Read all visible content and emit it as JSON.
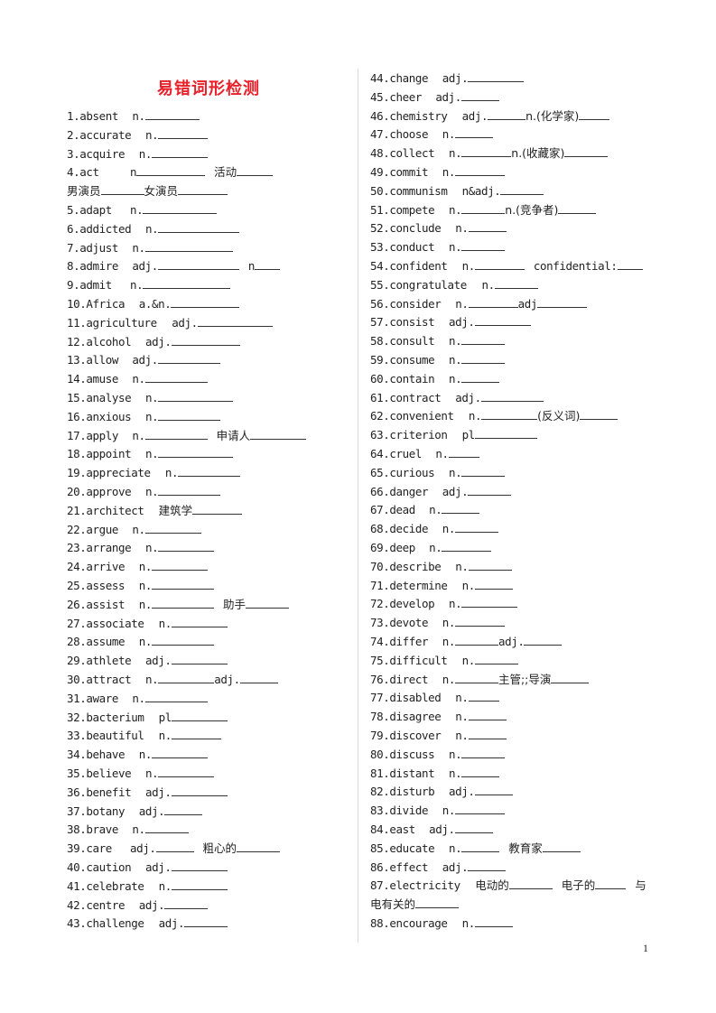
{
  "title": "易错词形检测",
  "page_number": "1",
  "left_items": [
    {
      "n": "1",
      "word": "absent",
      "parts": [
        [
          "n.",
          60
        ]
      ]
    },
    {
      "n": "2",
      "word": "accurate",
      "parts": [
        [
          "n.",
          55
        ]
      ]
    },
    {
      "n": "3",
      "word": "acquire",
      "parts": [
        [
          "n.",
          62
        ]
      ]
    },
    {
      "n": "4",
      "word": "act",
      "parts": [
        [
          "n",
          76
        ],
        [
          "活动",
          40
        ]
      ]
    },
    {
      "n": "",
      "word": "",
      "parts": [
        [
          "男演员",
          48
        ],
        [
          "女演员",
          55
        ]
      ],
      "continuation": true
    },
    {
      "n": "5",
      "word": "adapt",
      "parts": [
        [
          "n.",
          82
        ]
      ]
    },
    {
      "n": "6",
      "word": "addicted",
      "parts": [
        [
          "n.",
          90
        ]
      ]
    },
    {
      "n": "7",
      "word": "adjust",
      "parts": [
        [
          "n.",
          97
        ]
      ]
    },
    {
      "n": "8",
      "word": "admire",
      "parts": [
        [
          "adj.",
          90
        ],
        [
          "n",
          28
        ]
      ]
    },
    {
      "n": "9",
      "word": "admit",
      "parts": [
        [
          "n.",
          97
        ]
      ]
    },
    {
      "n": "10",
      "word": "Africa",
      "parts": [
        [
          "a.&n.",
          76
        ]
      ]
    },
    {
      "n": "11",
      "word": "agriculture",
      "parts": [
        [
          "adj.",
          83
        ]
      ]
    },
    {
      "n": "12",
      "word": "alcohol",
      "parts": [
        [
          "adj.",
          76
        ]
      ]
    },
    {
      "n": "13",
      "word": "allow",
      "parts": [
        [
          "adj.",
          69
        ]
      ]
    },
    {
      "n": "14",
      "word": "amuse",
      "parts": [
        [
          "n.",
          69
        ]
      ]
    },
    {
      "n": "15",
      "word": "analyse",
      "parts": [
        [
          "n.",
          83
        ]
      ]
    },
    {
      "n": "16",
      "word": "anxious",
      "parts": [
        [
          "n.",
          69
        ]
      ]
    },
    {
      "n": "17",
      "word": "apply",
      "parts": [
        [
          "n.",
          69
        ],
        [
          "申请人",
          62
        ]
      ]
    },
    {
      "n": "18",
      "word": "appoint",
      "parts": [
        [
          "n.",
          83
        ]
      ]
    },
    {
      "n": "19",
      "word": "appreciate",
      "parts": [
        [
          "n.",
          69
        ]
      ]
    },
    {
      "n": "20",
      "word": "approve",
      "parts": [
        [
          "n.",
          69
        ]
      ]
    },
    {
      "n": "21",
      "word": "architect",
      "parts": [
        [
          "建筑学",
          55
        ]
      ]
    },
    {
      "n": "22",
      "word": "argue",
      "parts": [
        [
          "n.",
          62
        ]
      ]
    },
    {
      "n": "23",
      "word": "arrange",
      "parts": [
        [
          "n.",
          62
        ]
      ]
    },
    {
      "n": "24",
      "word": "arrive",
      "parts": [
        [
          "n.",
          62
        ]
      ]
    },
    {
      "n": "25",
      "word": "assess",
      "parts": [
        [
          "n.",
          69
        ]
      ]
    },
    {
      "n": "26",
      "word": "assist",
      "parts": [
        [
          "n.",
          69
        ],
        [
          "助手",
          48
        ]
      ]
    },
    {
      "n": "27",
      "word": "associate",
      "parts": [
        [
          "n.",
          62
        ]
      ]
    },
    {
      "n": "28",
      "word": "assume",
      "parts": [
        [
          "n.",
          69
        ]
      ]
    },
    {
      "n": "29",
      "word": "athlete",
      "parts": [
        [
          "adj.",
          62
        ]
      ]
    },
    {
      "n": "30",
      "word": "attract",
      "parts": [
        [
          "n.",
          62
        ],
        [
          "adj.",
          42
        ]
      ]
    },
    {
      "n": "31",
      "word": "aware",
      "parts": [
        [
          "n.",
          69
        ]
      ]
    },
    {
      "n": "32",
      "word": "bacterium",
      "parts": [
        [
          "pl",
          62
        ]
      ]
    },
    {
      "n": "33",
      "word": "beautiful",
      "parts": [
        [
          "n.",
          55
        ]
      ]
    },
    {
      "n": "34",
      "word": "behave",
      "parts": [
        [
          "n.",
          62
        ]
      ]
    },
    {
      "n": "35",
      "word": "believe",
      "parts": [
        [
          "n.",
          62
        ]
      ]
    },
    {
      "n": "36",
      "word": "benefit",
      "parts": [
        [
          "adj.",
          62
        ]
      ]
    },
    {
      "n": "37",
      "word": "botany",
      "parts": [
        [
          "adj.",
          42
        ]
      ]
    },
    {
      "n": "38",
      "word": "brave",
      "parts": [
        [
          "n.",
          48
        ]
      ]
    },
    {
      "n": "39",
      "word": "care",
      "parts": [
        [
          "adj.",
          42
        ],
        [
          "粗心的",
          48
        ]
      ]
    },
    {
      "n": "40",
      "word": "caution",
      "parts": [
        [
          "adj.",
          62
        ]
      ]
    },
    {
      "n": "41",
      "word": "celebrate",
      "parts": [
        [
          "n.",
          62
        ]
      ]
    },
    {
      "n": "42",
      "word": "centre",
      "parts": [
        [
          "adj.",
          48
        ]
      ]
    },
    {
      "n": "43",
      "word": "challenge",
      "parts": [
        [
          "adj.",
          48
        ]
      ]
    }
  ],
  "right_items": [
    {
      "n": "44",
      "word": "change",
      "parts": [
        [
          "adj.",
          62
        ]
      ]
    },
    {
      "n": "45",
      "word": "cheer",
      "parts": [
        [
          "adj.",
          42
        ]
      ]
    },
    {
      "n": "46",
      "word": "chemistry",
      "parts": [
        [
          "adj.",
          42
        ],
        [
          "n.(化学家)",
          34
        ]
      ]
    },
    {
      "n": "47",
      "word": "choose",
      "parts": [
        [
          "n.",
          42
        ]
      ]
    },
    {
      "n": "48",
      "word": "collect",
      "parts": [
        [
          "n.",
          55
        ],
        [
          "n.(收藏家)",
          48
        ]
      ]
    },
    {
      "n": "49",
      "word": "commit",
      "parts": [
        [
          "n.",
          55
        ]
      ]
    },
    {
      "n": "50",
      "word": "communism",
      "parts": [
        [
          "n&adj.",
          48
        ]
      ]
    },
    {
      "n": "51",
      "word": "compete",
      "parts": [
        [
          "n.",
          48
        ],
        [
          "n.(竞争者)",
          42
        ]
      ]
    },
    {
      "n": "52",
      "word": "conclude",
      "parts": [
        [
          "n.",
          42
        ]
      ]
    },
    {
      "n": "53",
      "word": "conduct",
      "parts": [
        [
          "n.",
          48
        ]
      ]
    },
    {
      "n": "54",
      "word": "confident",
      "parts": [
        [
          "n.",
          55
        ],
        [
          "confidential:",
          28
        ]
      ]
    },
    {
      "n": "55",
      "word": "congratulate",
      "parts": [
        [
          "n.",
          48
        ]
      ]
    },
    {
      "n": "56",
      "word": "consider",
      "parts": [
        [
          "n.",
          55
        ],
        [
          "adj",
          55
        ]
      ]
    },
    {
      "n": "57",
      "word": "consist",
      "parts": [
        [
          "adj.",
          62
        ]
      ]
    },
    {
      "n": "58",
      "word": "consult",
      "parts": [
        [
          "n.",
          48
        ]
      ]
    },
    {
      "n": "59",
      "word": "consume",
      "parts": [
        [
          "n.",
          48
        ]
      ]
    },
    {
      "n": "60",
      "word": "contain",
      "parts": [
        [
          "n.",
          42
        ]
      ]
    },
    {
      "n": "61",
      "word": "contract",
      "parts": [
        [
          "adj.",
          69
        ]
      ]
    },
    {
      "n": "62",
      "word": "convenient",
      "parts": [
        [
          "n.",
          62
        ],
        [
          "(反义词)",
          42
        ]
      ]
    },
    {
      "n": "63",
      "word": "criterion",
      "parts": [
        [
          "pl",
          69
        ]
      ]
    },
    {
      "n": "64",
      "word": "cruel",
      "parts": [
        [
          "n.",
          34
        ]
      ]
    },
    {
      "n": "65",
      "word": "curious",
      "parts": [
        [
          "n.",
          48
        ]
      ]
    },
    {
      "n": "66",
      "word": "danger",
      "parts": [
        [
          "adj.",
          48
        ]
      ]
    },
    {
      "n": "67",
      "word": "dead",
      "parts": [
        [
          "n.",
          42
        ]
      ]
    },
    {
      "n": "68",
      "word": "decide",
      "parts": [
        [
          "n.",
          48
        ]
      ]
    },
    {
      "n": "69",
      "word": "deep",
      "parts": [
        [
          "n.",
          55
        ]
      ]
    },
    {
      "n": "70",
      "word": "describe",
      "parts": [
        [
          "n.",
          48
        ]
      ]
    },
    {
      "n": "71",
      "word": "determine",
      "parts": [
        [
          "n.",
          42
        ]
      ]
    },
    {
      "n": "72",
      "word": "develop",
      "parts": [
        [
          "n.",
          62
        ]
      ]
    },
    {
      "n": "73",
      "word": "devote",
      "parts": [
        [
          "n.",
          55
        ]
      ]
    },
    {
      "n": "74",
      "word": "differ",
      "parts": [
        [
          "n.",
          48
        ],
        [
          "adj.",
          42
        ]
      ]
    },
    {
      "n": "75",
      "word": "difficult",
      "parts": [
        [
          "n.",
          48
        ]
      ]
    },
    {
      "n": "76",
      "word": "direct",
      "parts": [
        [
          "n.",
          48
        ],
        [
          "主管;;导演",
          42
        ]
      ]
    },
    {
      "n": "77",
      "word": "disabled",
      "parts": [
        [
          "n.",
          34
        ]
      ]
    },
    {
      "n": "78",
      "word": "disagree",
      "parts": [
        [
          "n.",
          42
        ]
      ]
    },
    {
      "n": "79",
      "word": "discover",
      "parts": [
        [
          "n.",
          42
        ]
      ]
    },
    {
      "n": "80",
      "word": "discuss",
      "parts": [
        [
          "n.",
          48
        ]
      ]
    },
    {
      "n": "81",
      "word": "distant",
      "parts": [
        [
          "n.",
          42
        ]
      ]
    },
    {
      "n": "82",
      "word": "disturb",
      "parts": [
        [
          "adj.",
          42
        ]
      ]
    },
    {
      "n": "83",
      "word": "divide",
      "parts": [
        [
          "n.",
          55
        ]
      ]
    },
    {
      "n": "84",
      "word": "east",
      "parts": [
        [
          "adj.",
          42
        ]
      ]
    },
    {
      "n": "85",
      "word": "educate",
      "parts": [
        [
          "n.",
          42
        ],
        [
          "教育家",
          42
        ]
      ]
    },
    {
      "n": "86",
      "word": "effect",
      "parts": [
        [
          "adj.",
          42
        ]
      ]
    },
    {
      "n": "87",
      "word": "electricity",
      "parts": [
        [
          "电动的",
          48
        ],
        [
          "电子的",
          34
        ],
        [
          "与",
          0
        ]
      ]
    },
    {
      "n": "",
      "word": "",
      "parts": [
        [
          "电有关的",
          48
        ]
      ],
      "continuation": true
    },
    {
      "n": "88",
      "word": "encourage",
      "parts": [
        [
          "n.",
          42
        ]
      ]
    }
  ]
}
